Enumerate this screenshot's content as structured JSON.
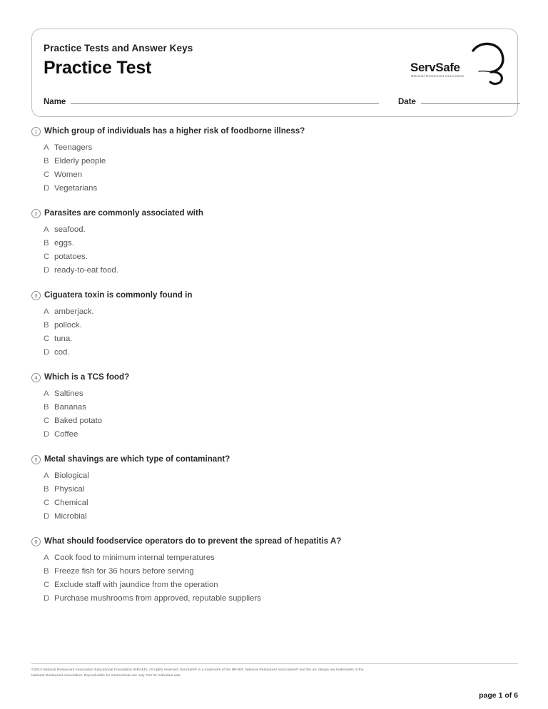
{
  "header": {
    "kicker": "Practice Tests and Answer Keys",
    "title": "Practice Test",
    "logo": {
      "wordmark": "ServSafe",
      "tagline": "National Restaurant Association",
      "arc_icon": "arc-swoosh-icon"
    },
    "fields": [
      {
        "label": "Name",
        "value": ""
      },
      {
        "label": "Date",
        "value": ""
      }
    ]
  },
  "questions": [
    {
      "number": "1",
      "text": "Which group of individuals has a higher risk of foodborne illness?",
      "options": [
        {
          "letter": "A",
          "text": "Teenagers"
        },
        {
          "letter": "B",
          "text": "Elderly people"
        },
        {
          "letter": "C",
          "text": "Women"
        },
        {
          "letter": "D",
          "text": "Vegetarians"
        }
      ]
    },
    {
      "number": "2",
      "text": "Parasites are commonly associated with",
      "options": [
        {
          "letter": "A",
          "text": "seafood."
        },
        {
          "letter": "B",
          "text": "eggs."
        },
        {
          "letter": "C",
          "text": "potatoes."
        },
        {
          "letter": "D",
          "text": "ready-to-eat food."
        }
      ]
    },
    {
      "number": "3",
      "text": "Ciguatera toxin is commonly found in",
      "options": [
        {
          "letter": "A",
          "text": "amberjack."
        },
        {
          "letter": "B",
          "text": "pollock."
        },
        {
          "letter": "C",
          "text": "tuna."
        },
        {
          "letter": "D",
          "text": "cod."
        }
      ]
    },
    {
      "number": "4",
      "text": "Which is a TCS food?",
      "options": [
        {
          "letter": "A",
          "text": "Saltines"
        },
        {
          "letter": "B",
          "text": "Bananas"
        },
        {
          "letter": "C",
          "text": "Baked potato"
        },
        {
          "letter": "D",
          "text": "Coffee"
        }
      ]
    },
    {
      "number": "5",
      "text": "Metal shavings are which type of contaminant?",
      "options": [
        {
          "letter": "A",
          "text": "Biological"
        },
        {
          "letter": "B",
          "text": "Physical"
        },
        {
          "letter": "C",
          "text": "Chemical"
        },
        {
          "letter": "D",
          "text": "Microbial"
        }
      ]
    },
    {
      "number": "6",
      "text": "What should foodservice operators do to prevent the spread of hepatitis A?",
      "options": [
        {
          "letter": "A",
          "text": "Cook food to minimum internal temperatures"
        },
        {
          "letter": "B",
          "text": "Freeze fish for 36 hours before serving"
        },
        {
          "letter": "C",
          "text": "Exclude staff with jaundice from the operation"
        },
        {
          "letter": "D",
          "text": "Purchase mushrooms from approved, reputable suppliers"
        }
      ]
    }
  ],
  "footer": {
    "legal_line_1": "©2014 National Restaurant Association Educational Foundation (NRAEF). All rights reserved. ServSafe® is a trademark of the NRAEF. National Restaurant Association® and the arc design are trademarks of the",
    "legal_line_2": "National Restaurant Association. Reproducible for instructional use only. Not for individual sale.",
    "page_label": "page 1 of 6"
  }
}
